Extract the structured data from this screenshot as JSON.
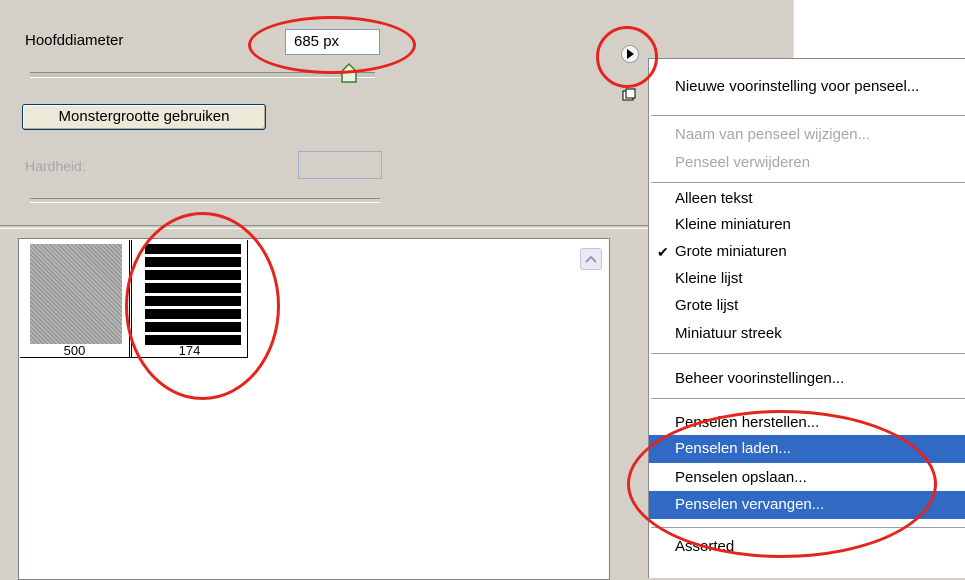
{
  "brush_options": {
    "diameter_label": "Hoofddiameter",
    "diameter_value": "685 px",
    "sample_size_button": "Monstergrootte gebruiken",
    "hardness_label": "Hardheid:"
  },
  "presets": {
    "items": [
      {
        "size_label": "500",
        "type": "texture"
      },
      {
        "size_label": "174",
        "type": "stripes"
      }
    ]
  },
  "flyout_menu": {
    "items": [
      {
        "label": "Nieuwe voorinstelling voor penseel...",
        "enabled": true
      },
      {
        "label": "Naam van penseel wijzigen...",
        "enabled": false
      },
      {
        "label": "Penseel verwijderen",
        "enabled": false
      },
      {
        "label": "Alleen tekst",
        "enabled": true
      },
      {
        "label": "Kleine miniaturen",
        "enabled": true
      },
      {
        "label": "Grote miniaturen",
        "enabled": true,
        "checked": true
      },
      {
        "label": "Kleine lijst",
        "enabled": true
      },
      {
        "label": "Grote lijst",
        "enabled": true
      },
      {
        "label": "Miniatuur streek",
        "enabled": true
      },
      {
        "label": "Beheer voorinstellingen...",
        "enabled": true
      },
      {
        "label": "Penselen herstellen...",
        "enabled": true
      },
      {
        "label": "Penselen laden...",
        "enabled": true,
        "highlighted": true
      },
      {
        "label": "Penselen opslaan...",
        "enabled": true
      },
      {
        "label": "Penselen vervangen...",
        "enabled": true,
        "highlighted": true
      },
      {
        "label": "Assorted",
        "enabled": true
      }
    ]
  },
  "icons": {
    "menu_arrow": "play-arrow-icon",
    "new_preset": "new-preset-icon",
    "checkmark": "checkmark-icon"
  },
  "colors": {
    "highlight": "#316ac5",
    "annotation": "#e5241e",
    "panel_bg": "#d4d0c8"
  }
}
